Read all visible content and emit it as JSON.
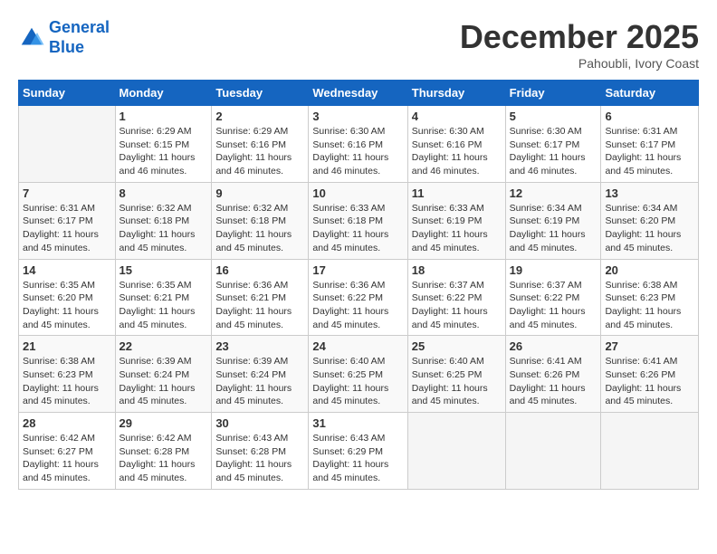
{
  "header": {
    "logo_line1": "General",
    "logo_line2": "Blue",
    "month": "December 2025",
    "location": "Pahoubli, Ivory Coast"
  },
  "weekdays": [
    "Sunday",
    "Monday",
    "Tuesday",
    "Wednesday",
    "Thursday",
    "Friday",
    "Saturday"
  ],
  "weeks": [
    [
      {
        "day": "",
        "sunrise": "",
        "sunset": "",
        "daylight": ""
      },
      {
        "day": "1",
        "sunrise": "Sunrise: 6:29 AM",
        "sunset": "Sunset: 6:15 PM",
        "daylight": "Daylight: 11 hours and 46 minutes."
      },
      {
        "day": "2",
        "sunrise": "Sunrise: 6:29 AM",
        "sunset": "Sunset: 6:16 PM",
        "daylight": "Daylight: 11 hours and 46 minutes."
      },
      {
        "day": "3",
        "sunrise": "Sunrise: 6:30 AM",
        "sunset": "Sunset: 6:16 PM",
        "daylight": "Daylight: 11 hours and 46 minutes."
      },
      {
        "day": "4",
        "sunrise": "Sunrise: 6:30 AM",
        "sunset": "Sunset: 6:16 PM",
        "daylight": "Daylight: 11 hours and 46 minutes."
      },
      {
        "day": "5",
        "sunrise": "Sunrise: 6:30 AM",
        "sunset": "Sunset: 6:17 PM",
        "daylight": "Daylight: 11 hours and 46 minutes."
      },
      {
        "day": "6",
        "sunrise": "Sunrise: 6:31 AM",
        "sunset": "Sunset: 6:17 PM",
        "daylight": "Daylight: 11 hours and 45 minutes."
      }
    ],
    [
      {
        "day": "7",
        "sunrise": "Sunrise: 6:31 AM",
        "sunset": "Sunset: 6:17 PM",
        "daylight": "Daylight: 11 hours and 45 minutes."
      },
      {
        "day": "8",
        "sunrise": "Sunrise: 6:32 AM",
        "sunset": "Sunset: 6:18 PM",
        "daylight": "Daylight: 11 hours and 45 minutes."
      },
      {
        "day": "9",
        "sunrise": "Sunrise: 6:32 AM",
        "sunset": "Sunset: 6:18 PM",
        "daylight": "Daylight: 11 hours and 45 minutes."
      },
      {
        "day": "10",
        "sunrise": "Sunrise: 6:33 AM",
        "sunset": "Sunset: 6:18 PM",
        "daylight": "Daylight: 11 hours and 45 minutes."
      },
      {
        "day": "11",
        "sunrise": "Sunrise: 6:33 AM",
        "sunset": "Sunset: 6:19 PM",
        "daylight": "Daylight: 11 hours and 45 minutes."
      },
      {
        "day": "12",
        "sunrise": "Sunrise: 6:34 AM",
        "sunset": "Sunset: 6:19 PM",
        "daylight": "Daylight: 11 hours and 45 minutes."
      },
      {
        "day": "13",
        "sunrise": "Sunrise: 6:34 AM",
        "sunset": "Sunset: 6:20 PM",
        "daylight": "Daylight: 11 hours and 45 minutes."
      }
    ],
    [
      {
        "day": "14",
        "sunrise": "Sunrise: 6:35 AM",
        "sunset": "Sunset: 6:20 PM",
        "daylight": "Daylight: 11 hours and 45 minutes."
      },
      {
        "day": "15",
        "sunrise": "Sunrise: 6:35 AM",
        "sunset": "Sunset: 6:21 PM",
        "daylight": "Daylight: 11 hours and 45 minutes."
      },
      {
        "day": "16",
        "sunrise": "Sunrise: 6:36 AM",
        "sunset": "Sunset: 6:21 PM",
        "daylight": "Daylight: 11 hours and 45 minutes."
      },
      {
        "day": "17",
        "sunrise": "Sunrise: 6:36 AM",
        "sunset": "Sunset: 6:22 PM",
        "daylight": "Daylight: 11 hours and 45 minutes."
      },
      {
        "day": "18",
        "sunrise": "Sunrise: 6:37 AM",
        "sunset": "Sunset: 6:22 PM",
        "daylight": "Daylight: 11 hours and 45 minutes."
      },
      {
        "day": "19",
        "sunrise": "Sunrise: 6:37 AM",
        "sunset": "Sunset: 6:22 PM",
        "daylight": "Daylight: 11 hours and 45 minutes."
      },
      {
        "day": "20",
        "sunrise": "Sunrise: 6:38 AM",
        "sunset": "Sunset: 6:23 PM",
        "daylight": "Daylight: 11 hours and 45 minutes."
      }
    ],
    [
      {
        "day": "21",
        "sunrise": "Sunrise: 6:38 AM",
        "sunset": "Sunset: 6:23 PM",
        "daylight": "Daylight: 11 hours and 45 minutes."
      },
      {
        "day": "22",
        "sunrise": "Sunrise: 6:39 AM",
        "sunset": "Sunset: 6:24 PM",
        "daylight": "Daylight: 11 hours and 45 minutes."
      },
      {
        "day": "23",
        "sunrise": "Sunrise: 6:39 AM",
        "sunset": "Sunset: 6:24 PM",
        "daylight": "Daylight: 11 hours and 45 minutes."
      },
      {
        "day": "24",
        "sunrise": "Sunrise: 6:40 AM",
        "sunset": "Sunset: 6:25 PM",
        "daylight": "Daylight: 11 hours and 45 minutes."
      },
      {
        "day": "25",
        "sunrise": "Sunrise: 6:40 AM",
        "sunset": "Sunset: 6:25 PM",
        "daylight": "Daylight: 11 hours and 45 minutes."
      },
      {
        "day": "26",
        "sunrise": "Sunrise: 6:41 AM",
        "sunset": "Sunset: 6:26 PM",
        "daylight": "Daylight: 11 hours and 45 minutes."
      },
      {
        "day": "27",
        "sunrise": "Sunrise: 6:41 AM",
        "sunset": "Sunset: 6:26 PM",
        "daylight": "Daylight: 11 hours and 45 minutes."
      }
    ],
    [
      {
        "day": "28",
        "sunrise": "Sunrise: 6:42 AM",
        "sunset": "Sunset: 6:27 PM",
        "daylight": "Daylight: 11 hours and 45 minutes."
      },
      {
        "day": "29",
        "sunrise": "Sunrise: 6:42 AM",
        "sunset": "Sunset: 6:28 PM",
        "daylight": "Daylight: 11 hours and 45 minutes."
      },
      {
        "day": "30",
        "sunrise": "Sunrise: 6:43 AM",
        "sunset": "Sunset: 6:28 PM",
        "daylight": "Daylight: 11 hours and 45 minutes."
      },
      {
        "day": "31",
        "sunrise": "Sunrise: 6:43 AM",
        "sunset": "Sunset: 6:29 PM",
        "daylight": "Daylight: 11 hours and 45 minutes."
      },
      {
        "day": "",
        "sunrise": "",
        "sunset": "",
        "daylight": ""
      },
      {
        "day": "",
        "sunrise": "",
        "sunset": "",
        "daylight": ""
      },
      {
        "day": "",
        "sunrise": "",
        "sunset": "",
        "daylight": ""
      }
    ]
  ]
}
